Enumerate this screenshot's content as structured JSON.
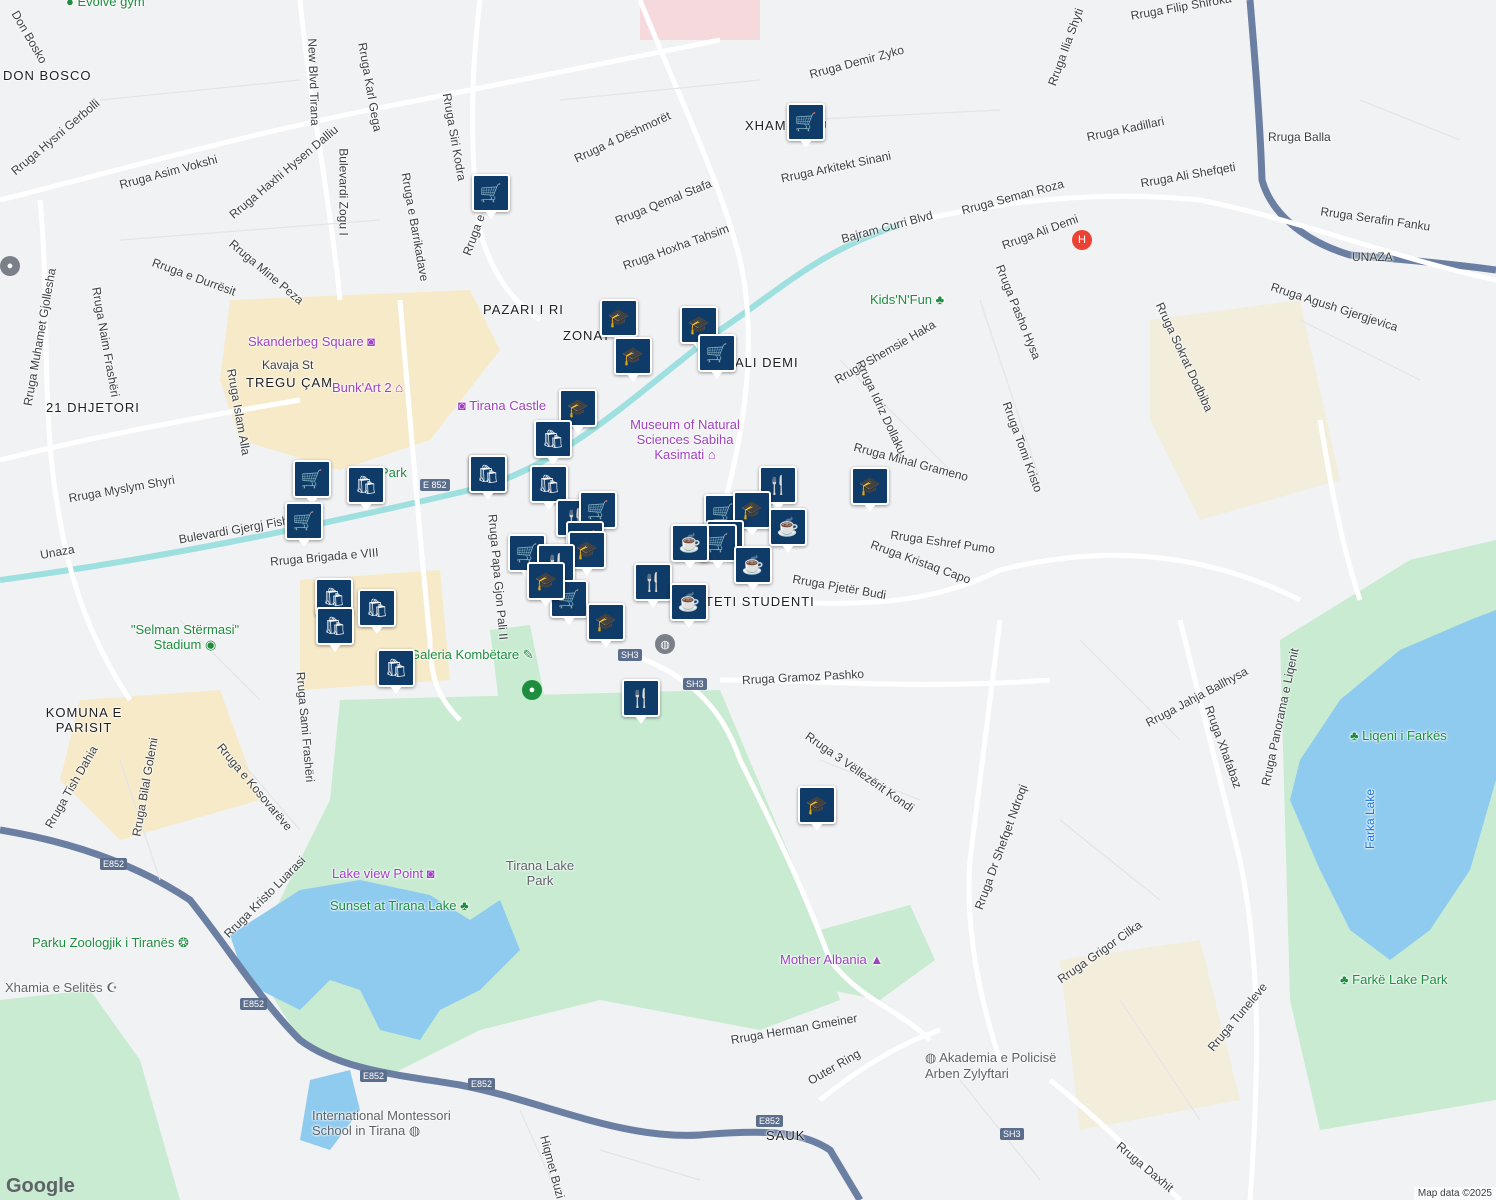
{
  "area_labels": [
    "DON BOSCO",
    "21 DHJETORI",
    "TREGU ÇAM",
    "PAZARI I RI",
    "ZONAT",
    "ALI DEMI",
    "XHAMLLIKU",
    "KOMUNA E PARISIT",
    "TETI STUDENTI",
    "SAUK"
  ],
  "street_labels": [
    "Don Bosko",
    "Rruga e Dibrës",
    "Rruga e Durrësit",
    "Rruga Asim Vokshi",
    "Bulevardi Zogu I",
    "New Blvd Tirana",
    "Rruga e Barrikadave",
    "Rruga Qemal Stafa",
    "Rruga Hoxha Tahsim",
    "Rruga 4 Dëshmorët",
    "Rruga Demir Zyko",
    "Rruga Arkitekt Sinani",
    "Bajram Curri Blvd",
    "Rruga Ali Demi",
    "Rruga Seman Roza",
    "Rruga Ali Shefqeti",
    "Rruga Kadillari",
    "Rruga Serafin Fanku",
    "UNAZA",
    "Rruga Agush Gjergjevica",
    "Rruga Sokrat Dodbiba",
    "Rruga Pasho Hysa",
    "Rruga Shemsie Haka",
    "Rruga Idriz Dollaku",
    "Rruga Mihal Grameno",
    "Rruga Eshref Pumo",
    "Rruga Kristaq Capo",
    "Rruga Pjetër Budi",
    "Rruga Gramoz Pashko",
    "Rruga 3 Vëllezërit Kondi",
    "Rruga Dr Shefqet Ndroqi",
    "Rruga Jahja Ballhysa",
    "Rruga Panorama e Liqenit",
    "Rruga Grigor Cilka",
    "Rruga Tuneleve",
    "Rruga Herman Gmeiner",
    "Outer Ring",
    "Rruga Daxhit",
    "Rruga Myslym Shyri",
    "Bulevardi Gjergj Fishta",
    "Unaza",
    "Rruga Brigada e VIII",
    "Rruga Papa Gjon Pali II",
    "Rruga Sami Frashëri",
    "Rruga e Kosovarëve",
    "Rruga Bilal Golemi",
    "Rruga Tish Dahia",
    "Rruga Kristo Luarasi",
    "Hiqmet Buzi",
    "Kavaja St",
    "Rruga Naim Frashëri",
    "Rruga Islam Alla",
    "Rruga Muhamet Gjollesha",
    "Rruga Hysni Gerbolli",
    "Rruga Haxhi Hysen Dalliu",
    "Rruga Siri Kodra",
    "Rruga Karl Gega",
    "Rruga Mine Peza",
    "Rruga Ilia Shyti",
    "Rruga Tomi Kristo",
    "Rruga Balla",
    "Rruga Xhafabaz",
    "Rruga Filip Shiroka"
  ],
  "poi_labels": [
    {
      "name": "Skanderbeg Square",
      "kind": "poi",
      "icon": "camera-icon"
    },
    {
      "name": "Bunk'Art 2",
      "kind": "poi",
      "icon": "museum-icon"
    },
    {
      "name": "Tirana Castle",
      "kind": "poi",
      "icon": "camera-icon"
    },
    {
      "name": "Museum of Natural Sciences Sabiha Kasimati",
      "kind": "poi",
      "icon": "museum-icon"
    },
    {
      "name": "Kids'N'Fun",
      "kind": "poi-green",
      "icon": "tree-icon"
    },
    {
      "name": "\"Selman Stërmasi\" Stadium",
      "kind": "poi-green",
      "icon": "stadium-icon"
    },
    {
      "name": "Tirana Lake Park",
      "kind": "poi-gray",
      "icon": ""
    },
    {
      "name": "Lake view Point",
      "kind": "poi",
      "icon": "camera-icon"
    },
    {
      "name": "Sunset at Tirana Lake",
      "kind": "poi-green",
      "icon": "tree-icon"
    },
    {
      "name": "Parku Zoologjik i Tiranës",
      "kind": "poi-green",
      "icon": "paw-icon"
    },
    {
      "name": "Xhamia e Selitës",
      "kind": "poi-gray",
      "icon": "mosque-icon"
    },
    {
      "name": "Mother Albania",
      "kind": "poi",
      "icon": "monument-icon"
    },
    {
      "name": "Akademia e Policisë Arben Zylyftari",
      "kind": "poi-gray",
      "icon": "school-icon"
    },
    {
      "name": "International Montessori School in Tirana",
      "kind": "poi-gray",
      "icon": "school-icon"
    },
    {
      "name": "Liqeni i Farkës",
      "kind": "poi-green",
      "icon": "tree-icon"
    },
    {
      "name": "Farka Lake",
      "kind": "water",
      "icon": ""
    },
    {
      "name": "Farkë Lake Park",
      "kind": "poi-green",
      "icon": "tree-icon"
    },
    {
      "name": "Evolve gym",
      "kind": "poi-green",
      "icon": "gym-icon"
    },
    {
      "name": "Park",
      "kind": "poi-green",
      "icon": ""
    },
    {
      "name": "Galeria Kombëtare",
      "kind": "poi-green",
      "icon": "art-icon"
    }
  ],
  "road_shields": [
    "E 852",
    "SH3",
    "SH3",
    "E852",
    "E852",
    "E852",
    "E852",
    "E852",
    "SH3"
  ],
  "markers": [
    {
      "type": "grocery",
      "icon": "cart-icon"
    },
    {
      "type": "grocery",
      "icon": "cart-icon"
    },
    {
      "type": "school",
      "icon": "school-cap-icon"
    },
    {
      "type": "school",
      "icon": "school-cap-icon"
    },
    {
      "type": "grocery",
      "icon": "cart-icon"
    },
    {
      "type": "school",
      "icon": "school-cap-icon"
    },
    {
      "type": "school",
      "icon": "school-cap-icon"
    },
    {
      "type": "shop",
      "icon": "bag-icon"
    },
    {
      "type": "shop",
      "icon": "bag-icon"
    },
    {
      "type": "grocery",
      "icon": "cart-icon"
    },
    {
      "type": "grocery",
      "icon": "cart-icon"
    },
    {
      "type": "shop",
      "icon": "bag-icon"
    },
    {
      "type": "shop",
      "icon": "bag-icon"
    },
    {
      "type": "shop",
      "icon": "bag-icon"
    },
    {
      "type": "restaurant",
      "icon": "fork-knife-icon"
    },
    {
      "type": "grocery",
      "icon": "cart-icon"
    },
    {
      "type": "grocery",
      "icon": "cart-icon"
    },
    {
      "type": "grocery",
      "icon": "cart-icon"
    },
    {
      "type": "school",
      "icon": "school-cap-icon"
    },
    {
      "type": "restaurant",
      "icon": "fork-knife-icon"
    },
    {
      "type": "grocery",
      "icon": "cart-icon"
    },
    {
      "type": "school",
      "icon": "school-cap-icon"
    },
    {
      "type": "shop",
      "icon": "bag-icon"
    },
    {
      "type": "shop",
      "icon": "bag-icon"
    },
    {
      "type": "shop",
      "icon": "bag-icon"
    },
    {
      "type": "shop",
      "icon": "bag-icon"
    },
    {
      "type": "restaurant",
      "icon": "fork-knife-icon"
    },
    {
      "type": "restaurant",
      "icon": "fork-knife-icon"
    },
    {
      "type": "restaurant",
      "icon": "fork-knife-icon"
    },
    {
      "type": "cafe",
      "icon": "coffee-icon"
    },
    {
      "type": "grocery",
      "icon": "cart-icon"
    },
    {
      "type": "school",
      "icon": "school-cap-icon"
    },
    {
      "type": "restaurant",
      "icon": "fork-knife-icon"
    },
    {
      "type": "cafe",
      "icon": "coffee-icon"
    },
    {
      "type": "grocery",
      "icon": "cart-icon"
    },
    {
      "type": "cafe",
      "icon": "coffee-icon"
    },
    {
      "type": "cafe",
      "icon": "coffee-icon"
    },
    {
      "type": "school",
      "icon": "school-cap-icon"
    },
    {
      "type": "school",
      "icon": "school-cap-icon"
    },
    {
      "type": "restaurant",
      "icon": "fork-knife-icon"
    }
  ],
  "hospital_icon": "hospital-icon",
  "footer": {
    "logo": "Google",
    "attribution": "Map data ©2025"
  },
  "colors": {
    "marker": "#0f3b68",
    "park": "#c8ebd2",
    "water": "#8ecbef",
    "built": "#f7eac8",
    "road": "#ffffff",
    "highway": "#6b7fa3",
    "tram": "#9ee0e0"
  }
}
